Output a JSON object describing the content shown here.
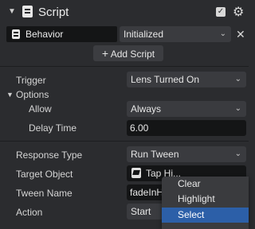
{
  "header": {
    "title": "Script"
  },
  "behavior": {
    "name": "Behavior",
    "state": "Initialized",
    "add_script_label": "Add Script"
  },
  "fields": {
    "trigger_label": "Trigger",
    "trigger_value": "Lens Turned On",
    "options_label": "Options",
    "allow_label": "Allow",
    "allow_value": "Always",
    "delay_label": "Delay Time",
    "delay_value": "6.00",
    "response_label": "Response Type",
    "response_value": "Run Tween",
    "target_label": "Target Object",
    "target_value": "Tap Hi...",
    "tween_label": "Tween Name",
    "tween_value": "fadeInH",
    "action_label": "Action",
    "action_value": "Start"
  },
  "context_menu": {
    "items": [
      "Clear",
      "Highlight",
      "Select"
    ],
    "selected": "Select"
  },
  "colors": {
    "accent": "#2c5fa8",
    "panel": "#2b2c2f",
    "field": "#3a3b3f",
    "input": "#141516"
  }
}
